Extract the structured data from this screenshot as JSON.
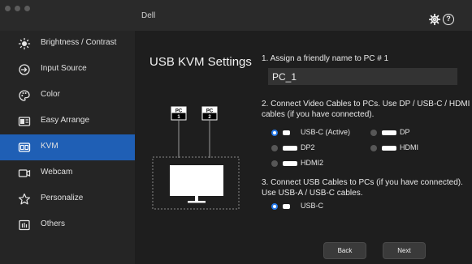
{
  "window": {
    "title": "Dell"
  },
  "sidebar": {
    "items": [
      {
        "label": "Brightness / Contrast",
        "icon": "brightness-icon"
      },
      {
        "label": "Input Source",
        "icon": "input-source-icon"
      },
      {
        "label": "Color",
        "icon": "color-palette-icon"
      },
      {
        "label": "Easy Arrange",
        "icon": "easy-arrange-icon"
      },
      {
        "label": "KVM",
        "icon": "kvm-icon",
        "active": true
      },
      {
        "label": "Webcam",
        "icon": "webcam-icon"
      },
      {
        "label": "Personalize",
        "icon": "star-icon"
      },
      {
        "label": "Others",
        "icon": "others-icon"
      }
    ]
  },
  "main": {
    "title": "USB KVM Settings",
    "diagram": {
      "pc1_top": "PC",
      "pc1_bottom": "1",
      "pc2_top": "PC",
      "pc2_bottom": "2"
    },
    "step1": {
      "label": "1. Assign a friendly name to PC # 1",
      "value": "PC_1"
    },
    "step2": {
      "label_line1": "2. Connect Video Cables to PCs. Use DP / USB-C / HDMI",
      "label_line2": "cables (if you have connected).",
      "options": [
        "USB-C (Active)",
        "DP",
        "DP2",
        "HDMI",
        "HDMI2"
      ],
      "selected": "USB-C (Active)"
    },
    "step3": {
      "label_line1": "3. Connect USB Cables to PCs (if you have connected).",
      "label_line2": "Use USB-A / USB-C cables.",
      "options": [
        "USB-C"
      ],
      "selected": "USB-C"
    },
    "buttons": {
      "back": "Back",
      "next": "Next"
    }
  },
  "colors": {
    "accent": "#1f5fb5",
    "radio_selected": "#2478e8"
  }
}
